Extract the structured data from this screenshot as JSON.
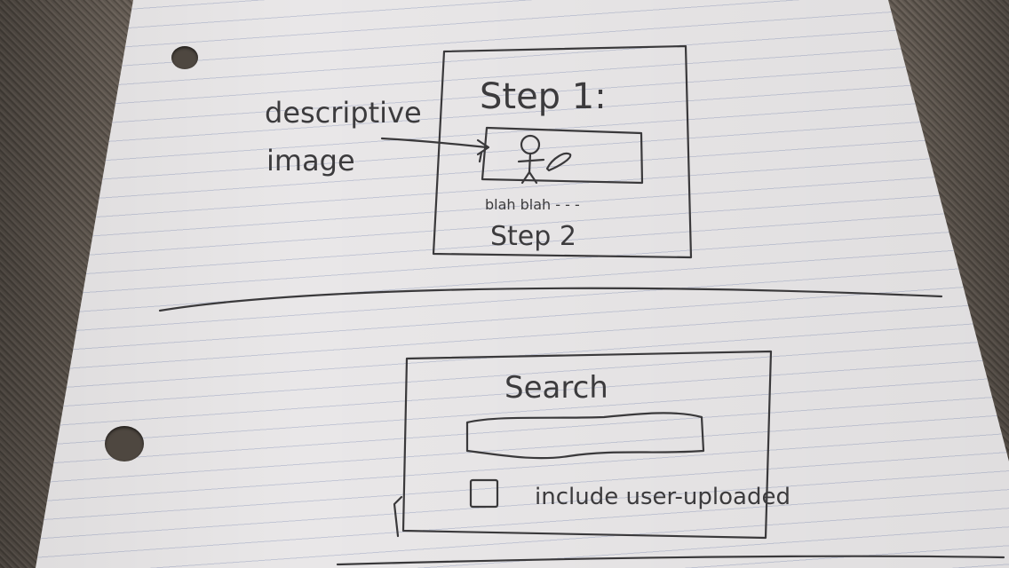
{
  "sketch": {
    "annotation": {
      "line1": "descriptive",
      "line2": "image"
    },
    "tutorial_card": {
      "step1": "Step 1:",
      "caption": "blah blah - - -",
      "step2": "Step 2"
    },
    "search_card": {
      "title": "Search",
      "checkbox_label": "include user-uploaded"
    }
  }
}
